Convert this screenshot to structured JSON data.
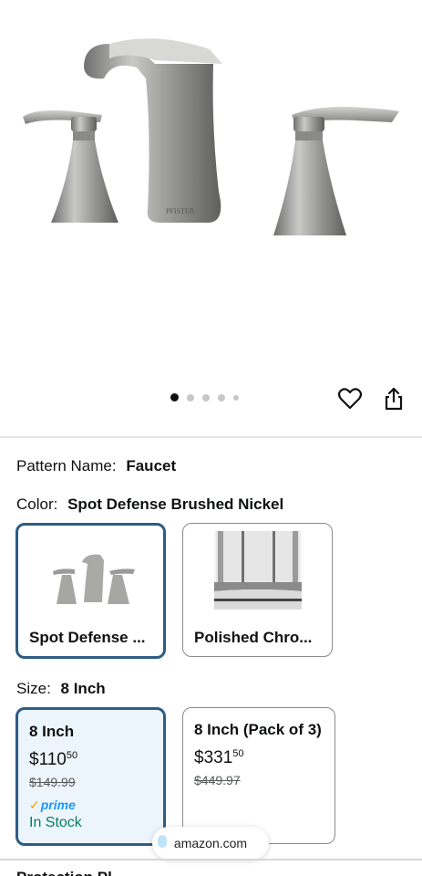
{
  "gallery": {
    "product_brand_mark": "PFISTER",
    "dot_count": 5,
    "active_index": 0
  },
  "actions": {
    "favorite_icon": "heart-icon",
    "share_icon": "share-icon"
  },
  "pattern": {
    "label": "Pattern Name:",
    "value": "Faucet"
  },
  "color": {
    "label": "Color:",
    "value": "Spot Defense Brushed Nickel",
    "options": [
      {
        "title": "Spot Defense ...",
        "selected": true
      },
      {
        "title": "Polished Chro...",
        "selected": false
      }
    ]
  },
  "size": {
    "label": "Size:",
    "value": "8 Inch",
    "options": [
      {
        "title": "8 Inch",
        "price_whole": "$110",
        "price_fraction": "50",
        "list_price": "$149.99",
        "prime": "prime",
        "stock": "In Stock",
        "selected": true
      },
      {
        "title": "8 Inch (Pack of 3)",
        "price_whole": "$331",
        "price_fraction": "50",
        "list_price": "$449.97",
        "selected": false
      }
    ]
  },
  "browser": {
    "domain": "amazon.com"
  },
  "next_section": {
    "title": "Protection Pl..."
  },
  "colors": {
    "selected_border": "#2d5c85",
    "selected_bg": "#edf5fc",
    "in_stock": "#067d62",
    "prime_blue": "#1a98ff",
    "prime_check": "#ff9900"
  }
}
